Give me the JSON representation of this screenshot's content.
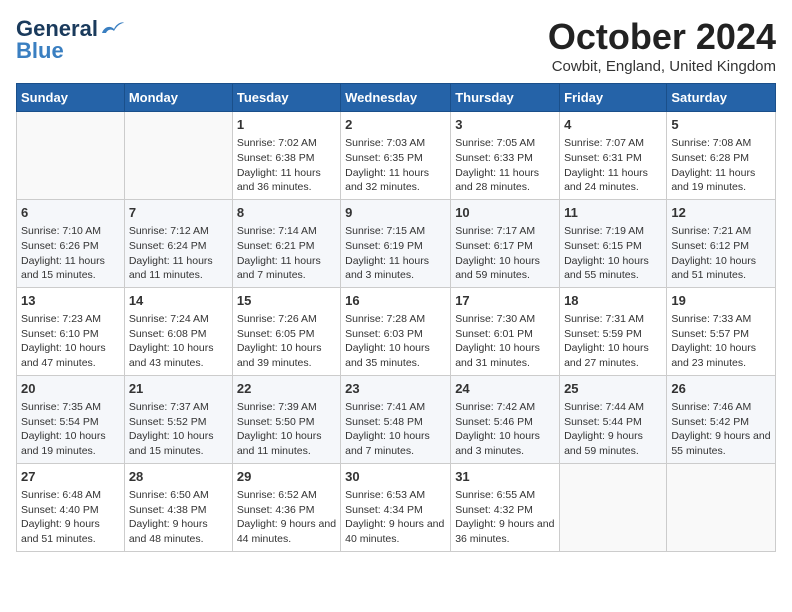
{
  "logo": {
    "general": "General",
    "blue": "Blue"
  },
  "title": "October 2024",
  "subtitle": "Cowbit, England, United Kingdom",
  "days_of_week": [
    "Sunday",
    "Monday",
    "Tuesday",
    "Wednesday",
    "Thursday",
    "Friday",
    "Saturday"
  ],
  "weeks": [
    [
      {
        "day": "",
        "sunrise": "",
        "sunset": "",
        "daylight": ""
      },
      {
        "day": "",
        "sunrise": "",
        "sunset": "",
        "daylight": ""
      },
      {
        "day": "1",
        "sunrise": "Sunrise: 7:02 AM",
        "sunset": "Sunset: 6:38 PM",
        "daylight": "Daylight: 11 hours and 36 minutes."
      },
      {
        "day": "2",
        "sunrise": "Sunrise: 7:03 AM",
        "sunset": "Sunset: 6:35 PM",
        "daylight": "Daylight: 11 hours and 32 minutes."
      },
      {
        "day": "3",
        "sunrise": "Sunrise: 7:05 AM",
        "sunset": "Sunset: 6:33 PM",
        "daylight": "Daylight: 11 hours and 28 minutes."
      },
      {
        "day": "4",
        "sunrise": "Sunrise: 7:07 AM",
        "sunset": "Sunset: 6:31 PM",
        "daylight": "Daylight: 11 hours and 24 minutes."
      },
      {
        "day": "5",
        "sunrise": "Sunrise: 7:08 AM",
        "sunset": "Sunset: 6:28 PM",
        "daylight": "Daylight: 11 hours and 19 minutes."
      }
    ],
    [
      {
        "day": "6",
        "sunrise": "Sunrise: 7:10 AM",
        "sunset": "Sunset: 6:26 PM",
        "daylight": "Daylight: 11 hours and 15 minutes."
      },
      {
        "day": "7",
        "sunrise": "Sunrise: 7:12 AM",
        "sunset": "Sunset: 6:24 PM",
        "daylight": "Daylight: 11 hours and 11 minutes."
      },
      {
        "day": "8",
        "sunrise": "Sunrise: 7:14 AM",
        "sunset": "Sunset: 6:21 PM",
        "daylight": "Daylight: 11 hours and 7 minutes."
      },
      {
        "day": "9",
        "sunrise": "Sunrise: 7:15 AM",
        "sunset": "Sunset: 6:19 PM",
        "daylight": "Daylight: 11 hours and 3 minutes."
      },
      {
        "day": "10",
        "sunrise": "Sunrise: 7:17 AM",
        "sunset": "Sunset: 6:17 PM",
        "daylight": "Daylight: 10 hours and 59 minutes."
      },
      {
        "day": "11",
        "sunrise": "Sunrise: 7:19 AM",
        "sunset": "Sunset: 6:15 PM",
        "daylight": "Daylight: 10 hours and 55 minutes."
      },
      {
        "day": "12",
        "sunrise": "Sunrise: 7:21 AM",
        "sunset": "Sunset: 6:12 PM",
        "daylight": "Daylight: 10 hours and 51 minutes."
      }
    ],
    [
      {
        "day": "13",
        "sunrise": "Sunrise: 7:23 AM",
        "sunset": "Sunset: 6:10 PM",
        "daylight": "Daylight: 10 hours and 47 minutes."
      },
      {
        "day": "14",
        "sunrise": "Sunrise: 7:24 AM",
        "sunset": "Sunset: 6:08 PM",
        "daylight": "Daylight: 10 hours and 43 minutes."
      },
      {
        "day": "15",
        "sunrise": "Sunrise: 7:26 AM",
        "sunset": "Sunset: 6:05 PM",
        "daylight": "Daylight: 10 hours and 39 minutes."
      },
      {
        "day": "16",
        "sunrise": "Sunrise: 7:28 AM",
        "sunset": "Sunset: 6:03 PM",
        "daylight": "Daylight: 10 hours and 35 minutes."
      },
      {
        "day": "17",
        "sunrise": "Sunrise: 7:30 AM",
        "sunset": "Sunset: 6:01 PM",
        "daylight": "Daylight: 10 hours and 31 minutes."
      },
      {
        "day": "18",
        "sunrise": "Sunrise: 7:31 AM",
        "sunset": "Sunset: 5:59 PM",
        "daylight": "Daylight: 10 hours and 27 minutes."
      },
      {
        "day": "19",
        "sunrise": "Sunrise: 7:33 AM",
        "sunset": "Sunset: 5:57 PM",
        "daylight": "Daylight: 10 hours and 23 minutes."
      }
    ],
    [
      {
        "day": "20",
        "sunrise": "Sunrise: 7:35 AM",
        "sunset": "Sunset: 5:54 PM",
        "daylight": "Daylight: 10 hours and 19 minutes."
      },
      {
        "day": "21",
        "sunrise": "Sunrise: 7:37 AM",
        "sunset": "Sunset: 5:52 PM",
        "daylight": "Daylight: 10 hours and 15 minutes."
      },
      {
        "day": "22",
        "sunrise": "Sunrise: 7:39 AM",
        "sunset": "Sunset: 5:50 PM",
        "daylight": "Daylight: 10 hours and 11 minutes."
      },
      {
        "day": "23",
        "sunrise": "Sunrise: 7:41 AM",
        "sunset": "Sunset: 5:48 PM",
        "daylight": "Daylight: 10 hours and 7 minutes."
      },
      {
        "day": "24",
        "sunrise": "Sunrise: 7:42 AM",
        "sunset": "Sunset: 5:46 PM",
        "daylight": "Daylight: 10 hours and 3 minutes."
      },
      {
        "day": "25",
        "sunrise": "Sunrise: 7:44 AM",
        "sunset": "Sunset: 5:44 PM",
        "daylight": "Daylight: 9 hours and 59 minutes."
      },
      {
        "day": "26",
        "sunrise": "Sunrise: 7:46 AM",
        "sunset": "Sunset: 5:42 PM",
        "daylight": "Daylight: 9 hours and 55 minutes."
      }
    ],
    [
      {
        "day": "27",
        "sunrise": "Sunrise: 6:48 AM",
        "sunset": "Sunset: 4:40 PM",
        "daylight": "Daylight: 9 hours and 51 minutes."
      },
      {
        "day": "28",
        "sunrise": "Sunrise: 6:50 AM",
        "sunset": "Sunset: 4:38 PM",
        "daylight": "Daylight: 9 hours and 48 minutes."
      },
      {
        "day": "29",
        "sunrise": "Sunrise: 6:52 AM",
        "sunset": "Sunset: 4:36 PM",
        "daylight": "Daylight: 9 hours and 44 minutes."
      },
      {
        "day": "30",
        "sunrise": "Sunrise: 6:53 AM",
        "sunset": "Sunset: 4:34 PM",
        "daylight": "Daylight: 9 hours and 40 minutes."
      },
      {
        "day": "31",
        "sunrise": "Sunrise: 6:55 AM",
        "sunset": "Sunset: 4:32 PM",
        "daylight": "Daylight: 9 hours and 36 minutes."
      },
      {
        "day": "",
        "sunrise": "",
        "sunset": "",
        "daylight": ""
      },
      {
        "day": "",
        "sunrise": "",
        "sunset": "",
        "daylight": ""
      }
    ]
  ]
}
